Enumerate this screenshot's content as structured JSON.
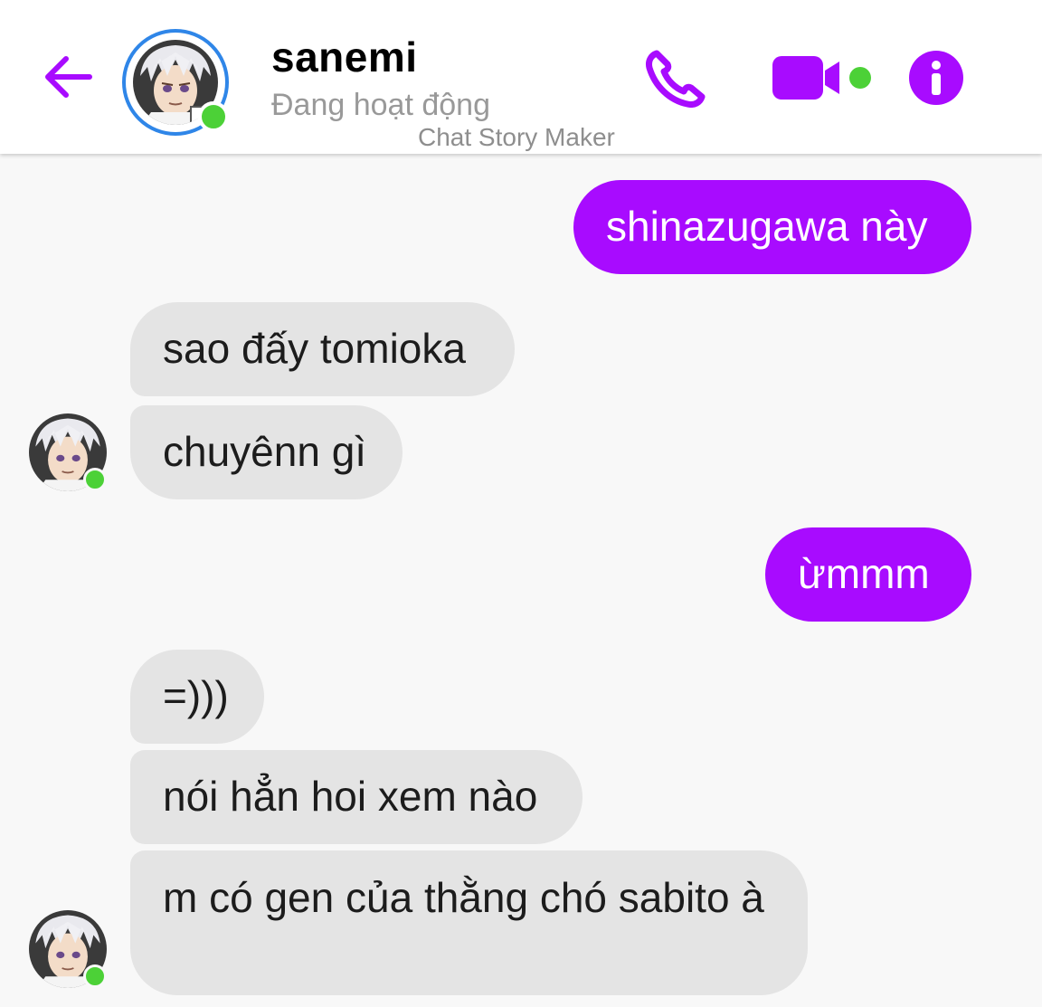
{
  "header": {
    "contact_name": "sanemi",
    "status": "Đang hoạt động",
    "watermark": "Chat Story Maker",
    "icons": {
      "back": "back-arrow-icon",
      "phone": "phone-icon",
      "video": "video-camera-icon",
      "info": "info-icon"
    }
  },
  "colors": {
    "accent": "#a80bff",
    "online": "#4cd137",
    "avatar_ring": "#2f86e8",
    "incoming_bubble": "#e4e4e4",
    "background": "#f8f8f8"
  },
  "messages": [
    {
      "direction": "outgoing",
      "text": "shinazugawa này"
    },
    {
      "direction": "incoming",
      "text": "sao đấy tomioka"
    },
    {
      "direction": "incoming",
      "text": "chuyênn gì"
    },
    {
      "direction": "outgoing",
      "text": "ừmmm"
    },
    {
      "direction": "incoming",
      "text": "=)))"
    },
    {
      "direction": "incoming",
      "text": "nói hẳn hoi xem nào"
    },
    {
      "direction": "incoming",
      "text": "m có gen của thằng chó sabito à"
    }
  ]
}
